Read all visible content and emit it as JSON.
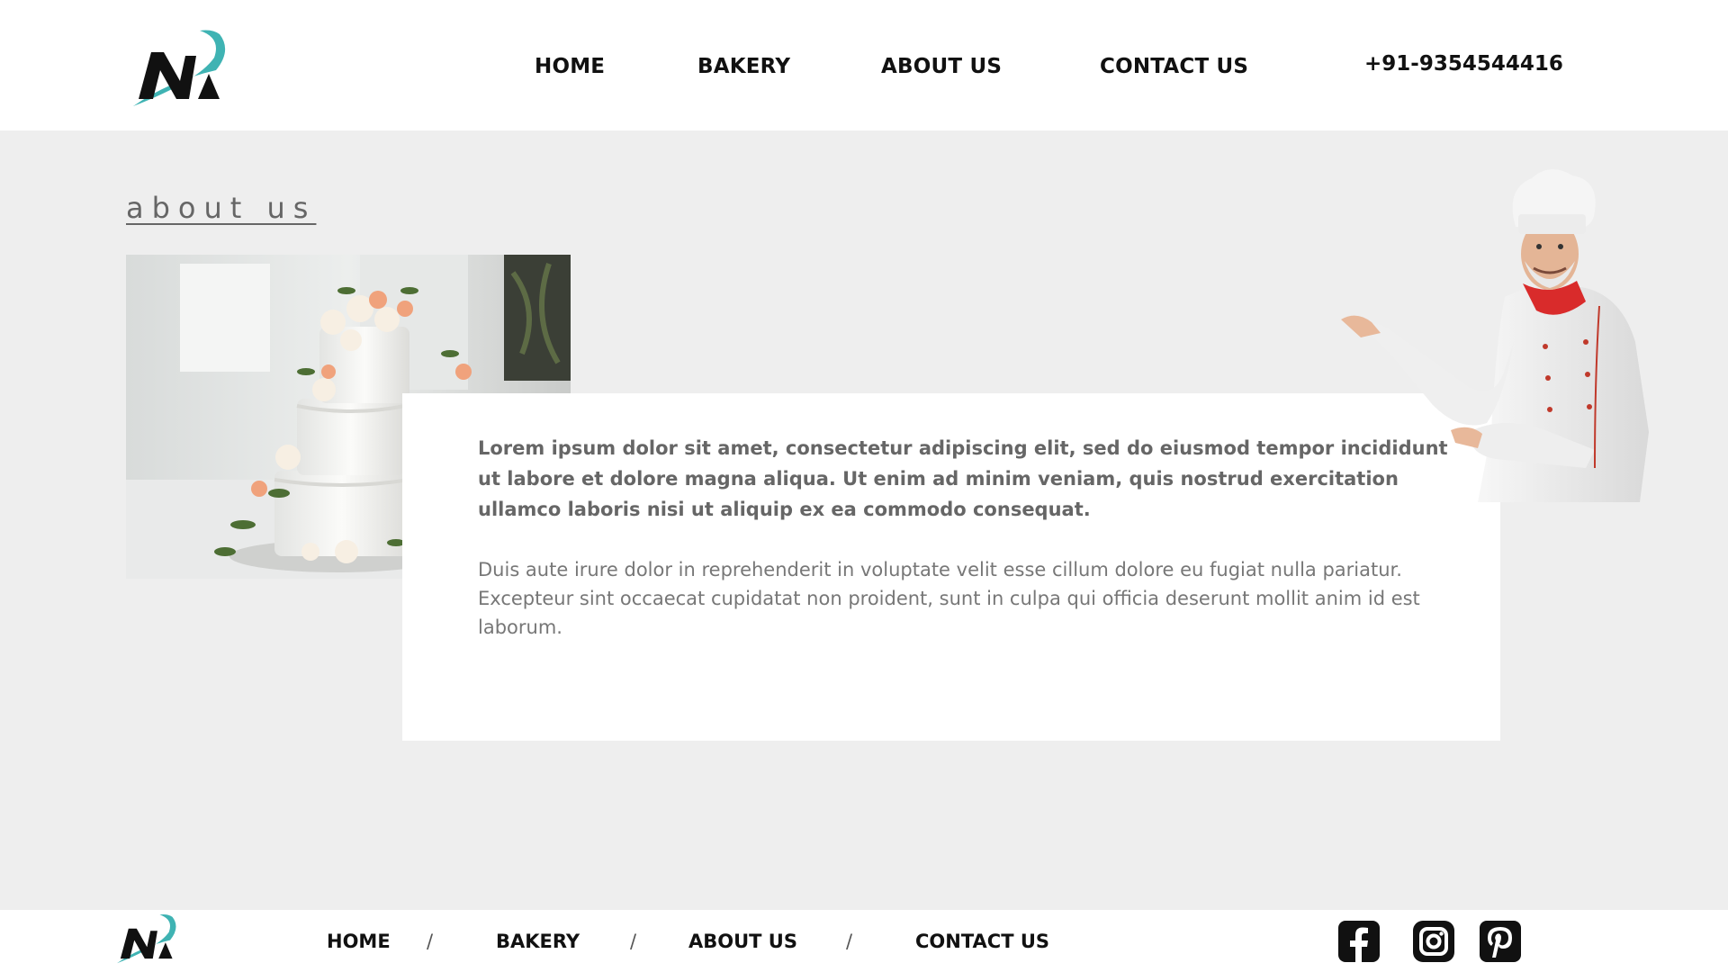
{
  "header": {
    "nav": [
      "HOME",
      "BAKERY",
      "ABOUT US",
      "CONTACT US"
    ],
    "phone": "+91-9354544416"
  },
  "main": {
    "heading": "about us",
    "paragraph_bold": "Lorem ipsum dolor sit amet, consectetur adipiscing elit, sed do eiusmod tempor incididunt ut labore et dolore magna aliqua. Ut enim ad minim veniam, quis nostrud exercitation ullamco laboris nisi ut aliquip ex ea commodo consequat.",
    "paragraph": "Duis aute irure dolor in reprehenderit in voluptate velit esse cillum dolore eu fugiat nulla pariatur. Excepteur sint occaecat cupidatat non proident, sunt in culpa qui officia deserunt mollit anim id est laborum."
  },
  "footer": {
    "nav": [
      "HOME",
      "BAKERY",
      "ABOUT US",
      "CONTACT US"
    ],
    "separator": "/",
    "social_icons": [
      "facebook-icon",
      "instagram-icon",
      "pinterest-icon"
    ]
  },
  "colors": {
    "brand_teal": "#3fb3b3",
    "page_background": "#eeeeee",
    "chef_scarf": "#d92b2b"
  }
}
